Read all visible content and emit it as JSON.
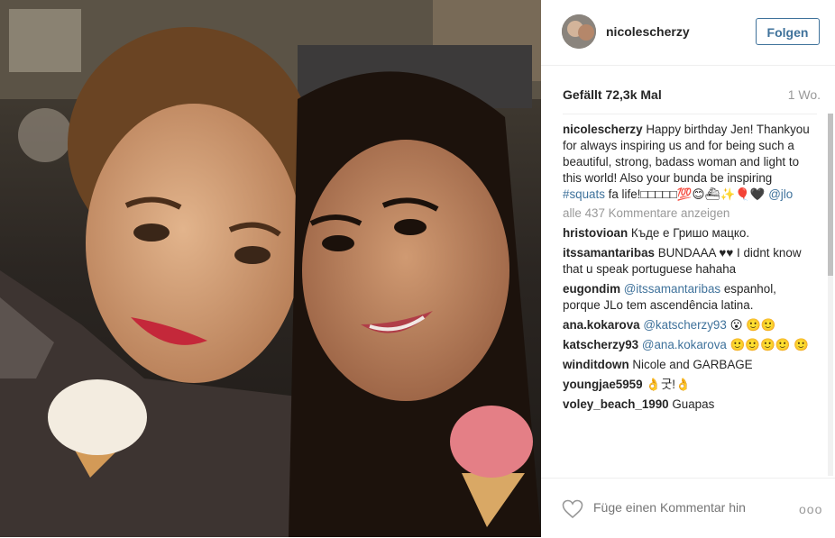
{
  "post": {
    "username": "nicolescherzy",
    "follow_label": "Folgen",
    "likes": "Gefällt 72,3k Mal",
    "time_ago": "1 Wo."
  },
  "caption": {
    "user": "nicolescherzy",
    "text": "Happy birthday Jen! Thankyou for always inspiring us and for being such a beautiful, strong, badass woman and light to this world! Also your bunda be inspiring",
    "hashtag": "#squats",
    "text2": "fa life!□□□□□💯😊⛴✨🎈🖤",
    "mention": "@jlo"
  },
  "load_more": "alle 437 Kommentare anzeigen",
  "comments": [
    {
      "user": "hristovioan",
      "text": "Къде е Гришо мацко."
    },
    {
      "user": "itssamantaribas",
      "text": "BUNDAAA ♥♥ I didnt know that u speak portuguese hahaha"
    },
    {
      "user": "eugondim",
      "mention": "@itssamantaribas",
      "text": "espanhol, porque JLo tem ascendência latina."
    },
    {
      "user": "ana.kokarova",
      "mention": "@katscherzy93",
      "text": "😮 🙂🙂"
    },
    {
      "user": "katscherzy93",
      "mention": "@ana.kokarova",
      "text": "🙂🙂🙂🙂 🙂"
    },
    {
      "user": "winditdown",
      "text": "Nicole and GARBAGE"
    },
    {
      "user": "youngjae5959",
      "text": "👌굿!👌"
    },
    {
      "user": "voley_beach_1990",
      "text": "Guapas"
    }
  ],
  "footer": {
    "comment_placeholder": "Füge einen Kommentar hin",
    "more_label": "ooo"
  }
}
